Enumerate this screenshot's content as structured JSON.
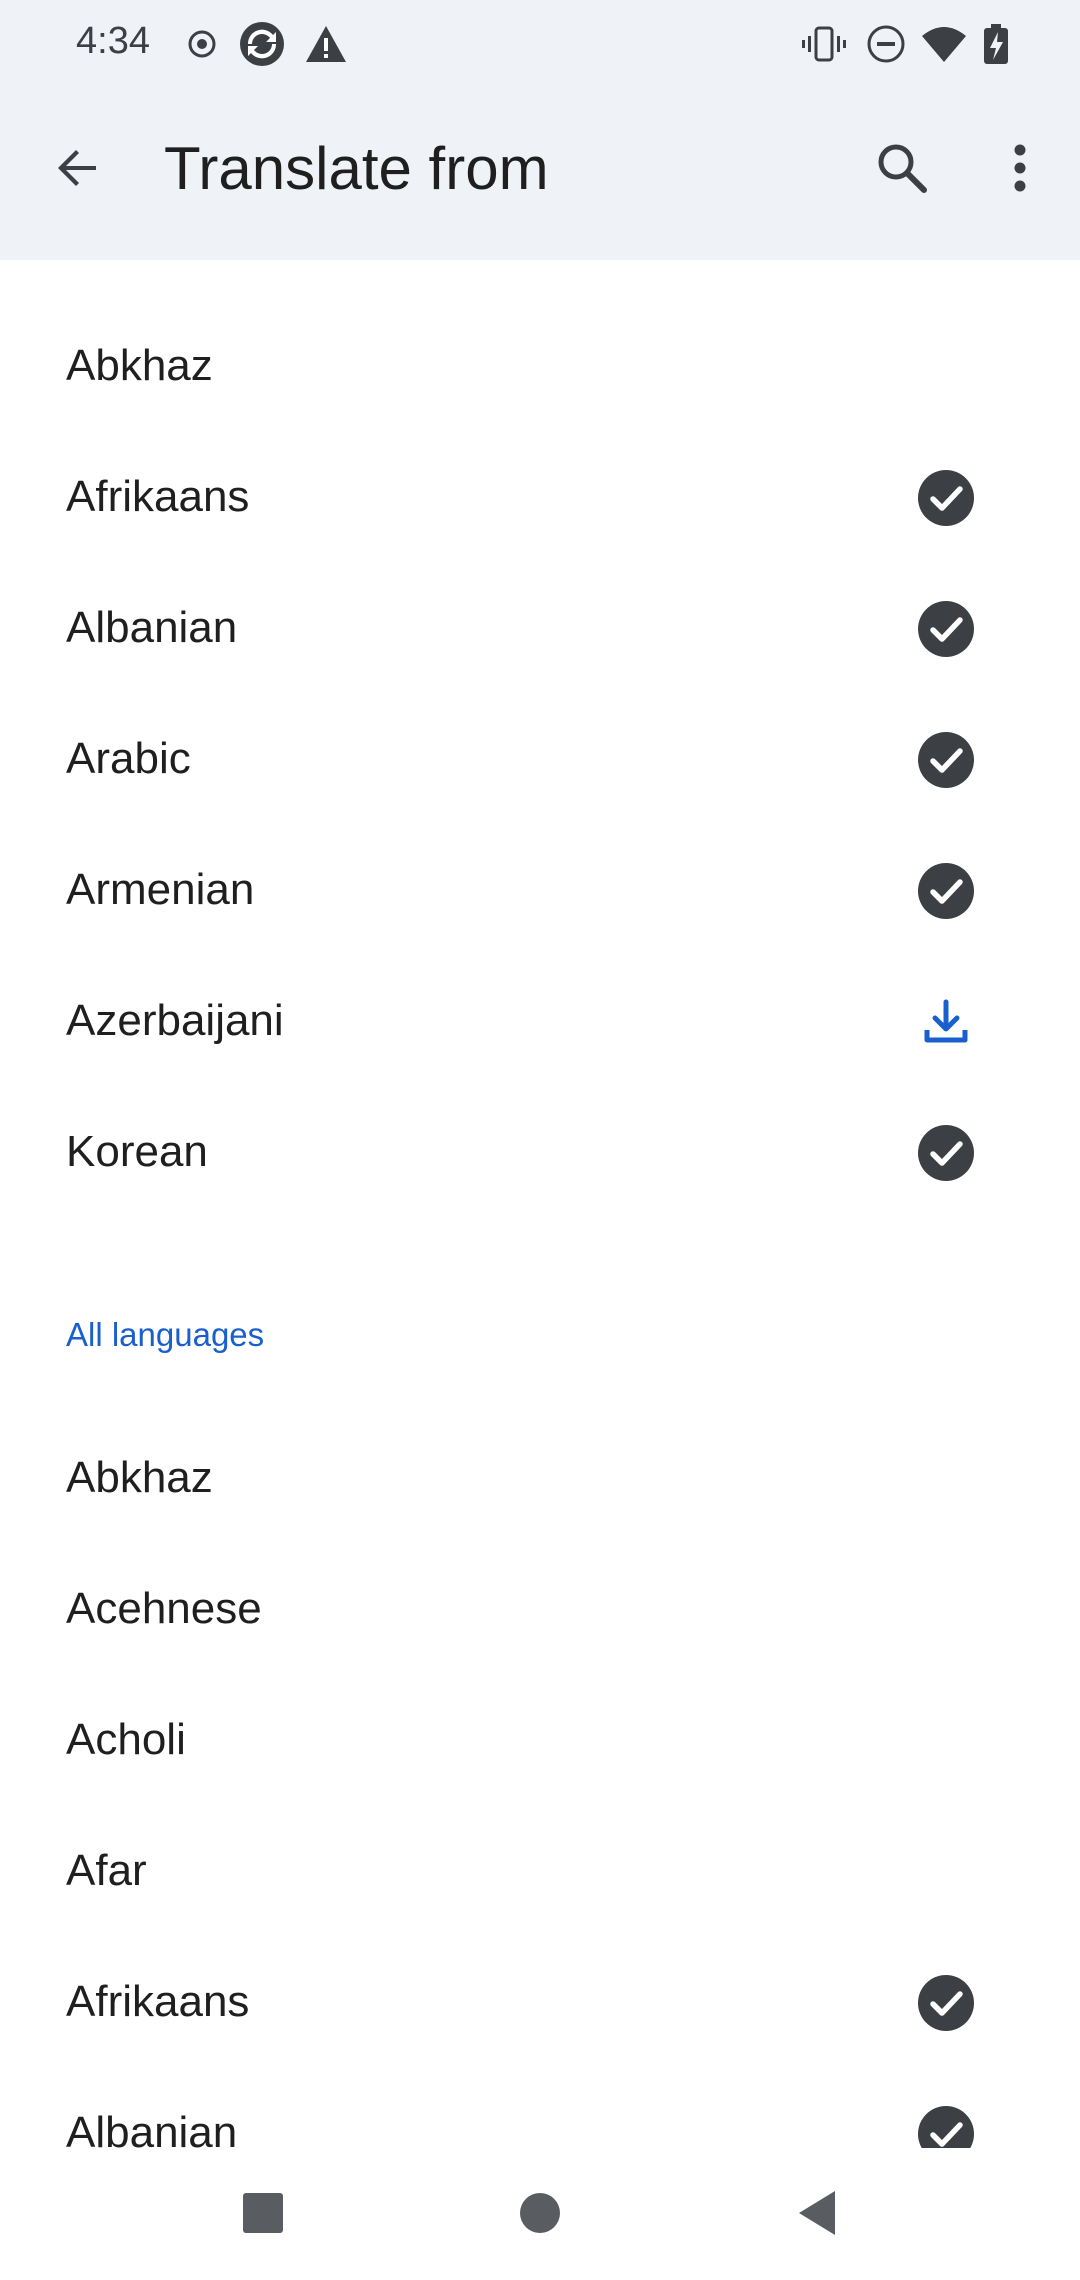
{
  "status_bar": {
    "time": "4:34",
    "left_icons": [
      "record-icon",
      "sync-icon",
      "alert-triangle-icon"
    ],
    "right_icons": [
      "vibrate-icon",
      "do-not-disturb-icon",
      "wifi-icon",
      "battery-charging-icon"
    ]
  },
  "app_bar": {
    "title": "Translate from",
    "back_icon": "arrow-back-icon",
    "search_icon": "search-icon",
    "more_icon": "more-vert-icon"
  },
  "colors": {
    "accent": "#1a5fce",
    "check_bg": "#3c3f44",
    "surface": "#eff3f8"
  },
  "recent_languages": [
    {
      "label": "Abkhaz",
      "status": "none"
    },
    {
      "label": "Afrikaans",
      "status": "downloaded"
    },
    {
      "label": "Albanian",
      "status": "downloaded"
    },
    {
      "label": "Arabic",
      "status": "downloaded"
    },
    {
      "label": "Armenian",
      "status": "downloaded"
    },
    {
      "label": "Azerbaijani",
      "status": "download"
    },
    {
      "label": "Korean",
      "status": "downloaded"
    }
  ],
  "all_languages_header": "All languages",
  "all_languages": [
    {
      "label": "Abkhaz",
      "status": "none"
    },
    {
      "label": "Acehnese",
      "status": "none"
    },
    {
      "label": "Acholi",
      "status": "none"
    },
    {
      "label": "Afar",
      "status": "none"
    },
    {
      "label": "Afrikaans",
      "status": "downloaded"
    },
    {
      "label": "Albanian",
      "status": "downloaded"
    }
  ],
  "nav_bar": {
    "recents_icon": "recents-square-icon",
    "home_icon": "home-circle-icon",
    "back_icon": "back-triangle-icon"
  }
}
